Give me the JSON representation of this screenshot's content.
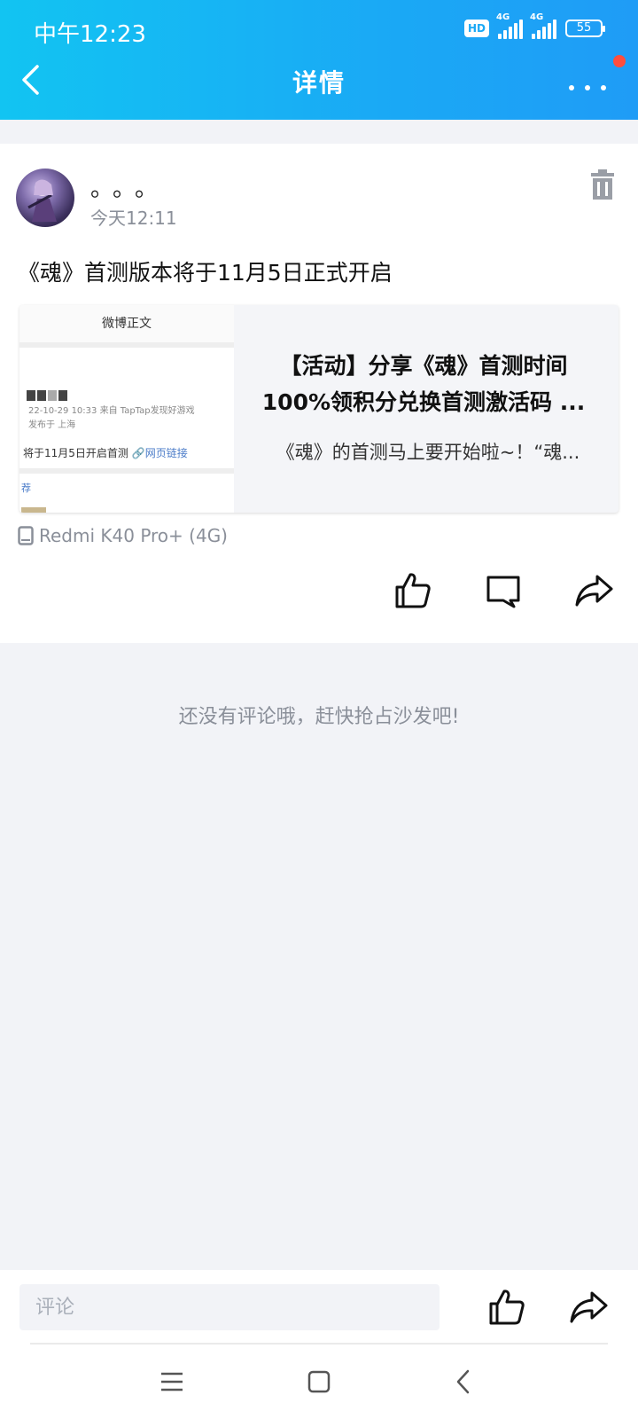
{
  "status_bar": {
    "time": "中午12:23",
    "hd": "HD",
    "signal1_tag": "4G",
    "signal2_tag": "4G",
    "battery": "55"
  },
  "nav": {
    "title": "详情",
    "back_icon": "chevron-left-icon",
    "more_icon": "more-dots-icon"
  },
  "post": {
    "username": "。。。",
    "time": "今天12:11",
    "text": "《魂》首测版本将于11月5日正式开启",
    "link_card": {
      "thumb_header": "微博正文",
      "thumb_meta_line1": "22-10-29 10:33  来自 TapTap发现好游戏",
      "thumb_meta_line2": "发布于 上海",
      "thumb_text": "将于11月5日开启首测",
      "thumb_link": "网页链接",
      "thumb_rec": "荐",
      "title_line1": "【活动】分享《魂》首测时间",
      "title_line2": "100%领积分兑换首测激活码 ...",
      "description": "《魂》的首测马上要开始啦~！“魂..."
    },
    "device": "Redmi K40 Pro+ (4G)"
  },
  "comments": {
    "empty_text": "还没有评论哦，赶快抢占沙发吧!"
  },
  "bottom_bar": {
    "comment_placeholder": "评论"
  },
  "colors": {
    "header_start": "#12c4f2",
    "header_end": "#1f9cf6",
    "notification_dot": "#ff4d3d",
    "muted_text": "#8a8f99"
  }
}
